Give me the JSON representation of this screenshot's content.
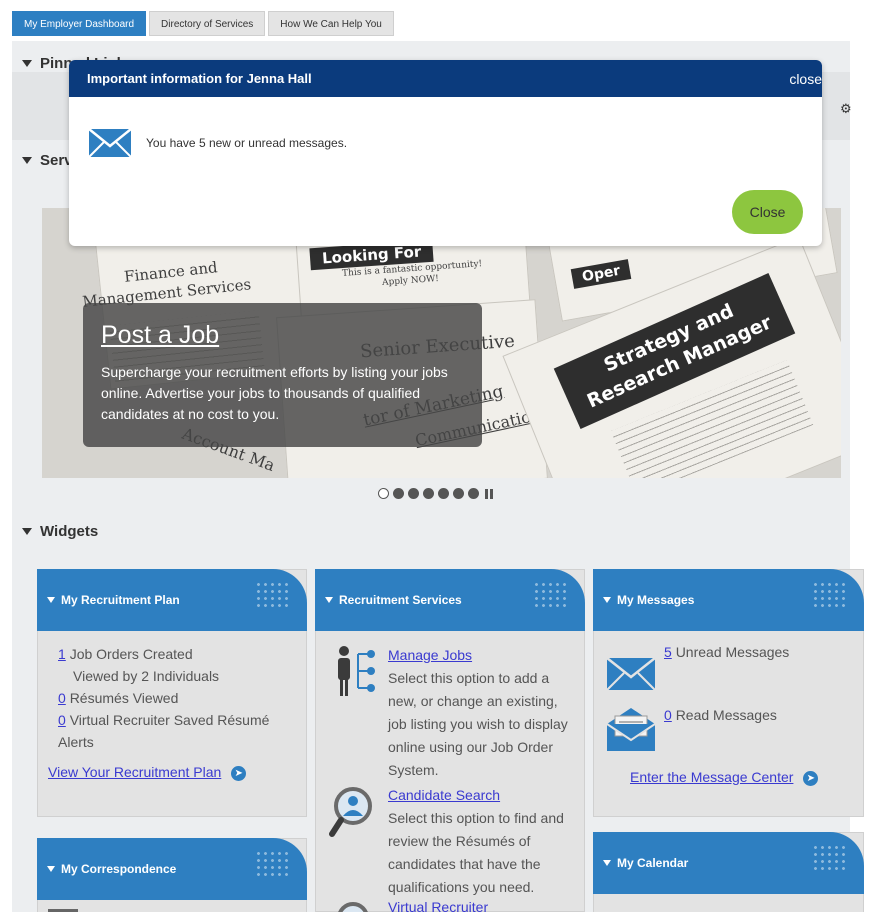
{
  "tabs": [
    {
      "label": "My Employer Dashboard",
      "active": true
    },
    {
      "label": "Directory of Services",
      "active": false
    },
    {
      "label": "How We Can Help You",
      "active": false
    }
  ],
  "sections": {
    "pinned": "Pinned Links",
    "services": "Services",
    "widgets": "Widgets"
  },
  "modal": {
    "title": "Important information for Jenna Hall",
    "close_link": "close",
    "message": "You have 5 new or unread messages.",
    "close_button": "Close"
  },
  "carousel": {
    "title": "Post a Job",
    "text": "Supercharge your recruitment efforts by listing your jobs online. Advertise your jobs to thousands of qualified candidates at no cost to you.",
    "image_text": {
      "finance": "Finance and",
      "management": "Management Services",
      "looking": "Looking For",
      "fantastic": "This is a fantastic opportunity!",
      "apply": "Apply NOW!",
      "senior": "Senior Executive",
      "strategy1": "Strategy and",
      "strategy2": "Research Manager",
      "oper": "Oper",
      "marketing": "tor of Marketing",
      "communication": "Communication",
      "account": "Account Ma"
    },
    "slide_count": 7,
    "active_slide": 1
  },
  "widgets": {
    "recruitment_plan": {
      "title": "My Recruitment Plan",
      "job_orders_count": "1",
      "job_orders_text": "Job Orders Created",
      "viewed_by": "Viewed by 2 Individuals",
      "resumes_count": "0",
      "resumes_text": "Résumés Viewed",
      "vr_count": "0",
      "vr_text": "Virtual Recruiter Saved Résumé Alerts",
      "link": "View Your Recruitment Plan"
    },
    "recruitment_services": {
      "title": "Recruitment Services",
      "manage_jobs": "Manage Jobs",
      "manage_jobs_desc": "Select this option to add a new, or change an existing, job listing you wish to display online using our Job Order System.",
      "candidate_search": "Candidate Search",
      "candidate_search_desc": "Select this option to find and review the Résumés of candidates that have the qualifications you need.",
      "virtual_recruiter": "Virtual Recruiter"
    },
    "messages": {
      "title": "My Messages",
      "unread_count": "5",
      "unread_text": "Unread Messages",
      "read_count": "0",
      "read_text": "Read Messages",
      "link": "Enter the Message Center"
    },
    "correspondence": {
      "title": "My Correspondence"
    },
    "calendar": {
      "title": "My Calendar"
    }
  },
  "colors": {
    "header_blue": "#2e7fc1",
    "modal_header": "#0b3b7d",
    "close_green": "#8dc63f",
    "link": "#3a3ad0"
  }
}
